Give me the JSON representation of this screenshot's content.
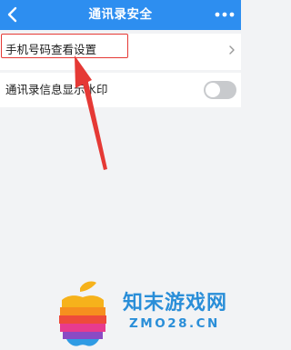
{
  "header": {
    "title": "通讯录安全",
    "back_icon": "chevron-left-icon",
    "more_icon": "more-dots-icon",
    "background": "#2d8ef0"
  },
  "settings": {
    "phone_view_label": "手机号码查看设置",
    "watermark_label": "通讯录信息显示水印",
    "watermark_toggle_on": false
  },
  "annotation": {
    "highlight_color": "#e53935"
  },
  "watermark": {
    "site_name": "知末游戏网",
    "site_url": "ZMO28.CN",
    "brand_color": "#2a8ed8"
  }
}
